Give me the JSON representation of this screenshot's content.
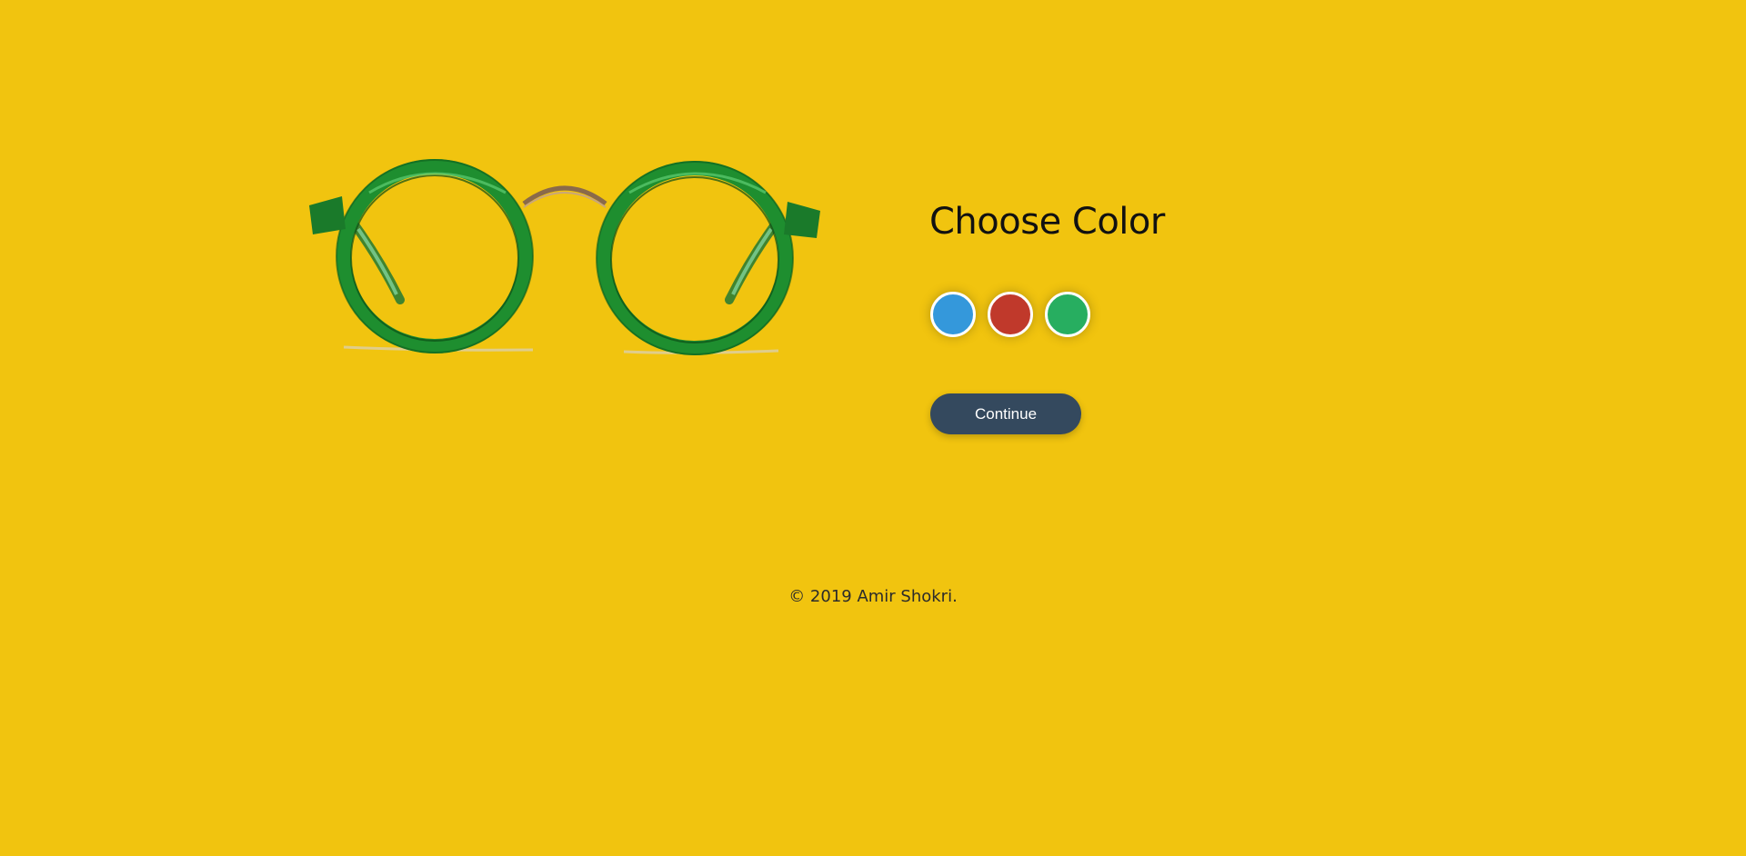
{
  "product": {
    "image_alt": "Green round eyeglasses",
    "frame_color": "#27ae60"
  },
  "chooser": {
    "title": "Choose Color",
    "swatches": [
      {
        "name": "blue",
        "color": "#3498db"
      },
      {
        "name": "red",
        "color": "#c0392b"
      },
      {
        "name": "green",
        "color": "#27ae60"
      }
    ],
    "continue_label": "Continue"
  },
  "footer": {
    "text": "© 2019 Amir Shokri."
  },
  "theme": {
    "background": "#f1c40f",
    "button": "#34495e"
  }
}
